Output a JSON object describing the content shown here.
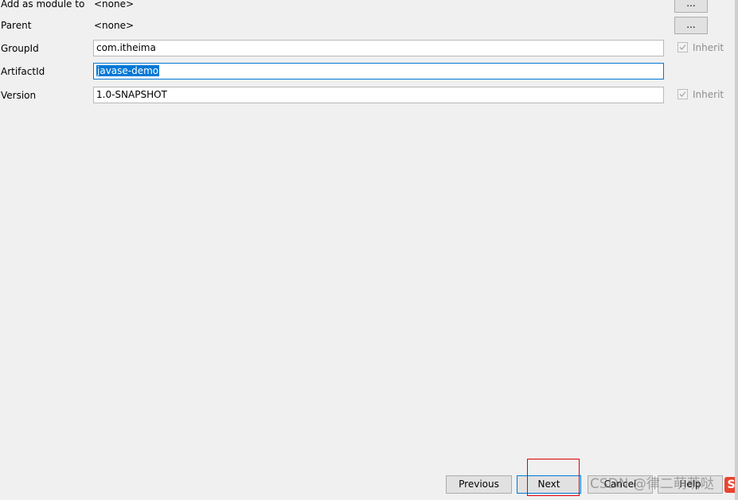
{
  "form": {
    "add_as_module_to": {
      "label": "Add as module to",
      "value": "<none>",
      "browse_label": "..."
    },
    "parent": {
      "label": "Parent",
      "value": "<none>",
      "browse_label": "..."
    },
    "group_id": {
      "label": "GroupId",
      "value": "com.itheima",
      "inherit_label": "Inherit",
      "inherit_checked": true
    },
    "artifact_id": {
      "label": "ArtifactId",
      "value": "javase-demo"
    },
    "version": {
      "label": "Version",
      "value": "1.0-SNAPSHOT",
      "inherit_label": "Inherit",
      "inherit_checked": true
    }
  },
  "buttons": {
    "previous_label": "Previous",
    "next_label": "Next",
    "cancel_label": "Cancel",
    "help_label": "Help"
  },
  "watermark": {
    "text": "CSDN @律二萌萌哒",
    "logo_text": "S"
  },
  "colors": {
    "background": "#f0f0f0",
    "focus_border": "#0078d7",
    "selection": "#0078d7",
    "annotation_box": "#e00000"
  }
}
